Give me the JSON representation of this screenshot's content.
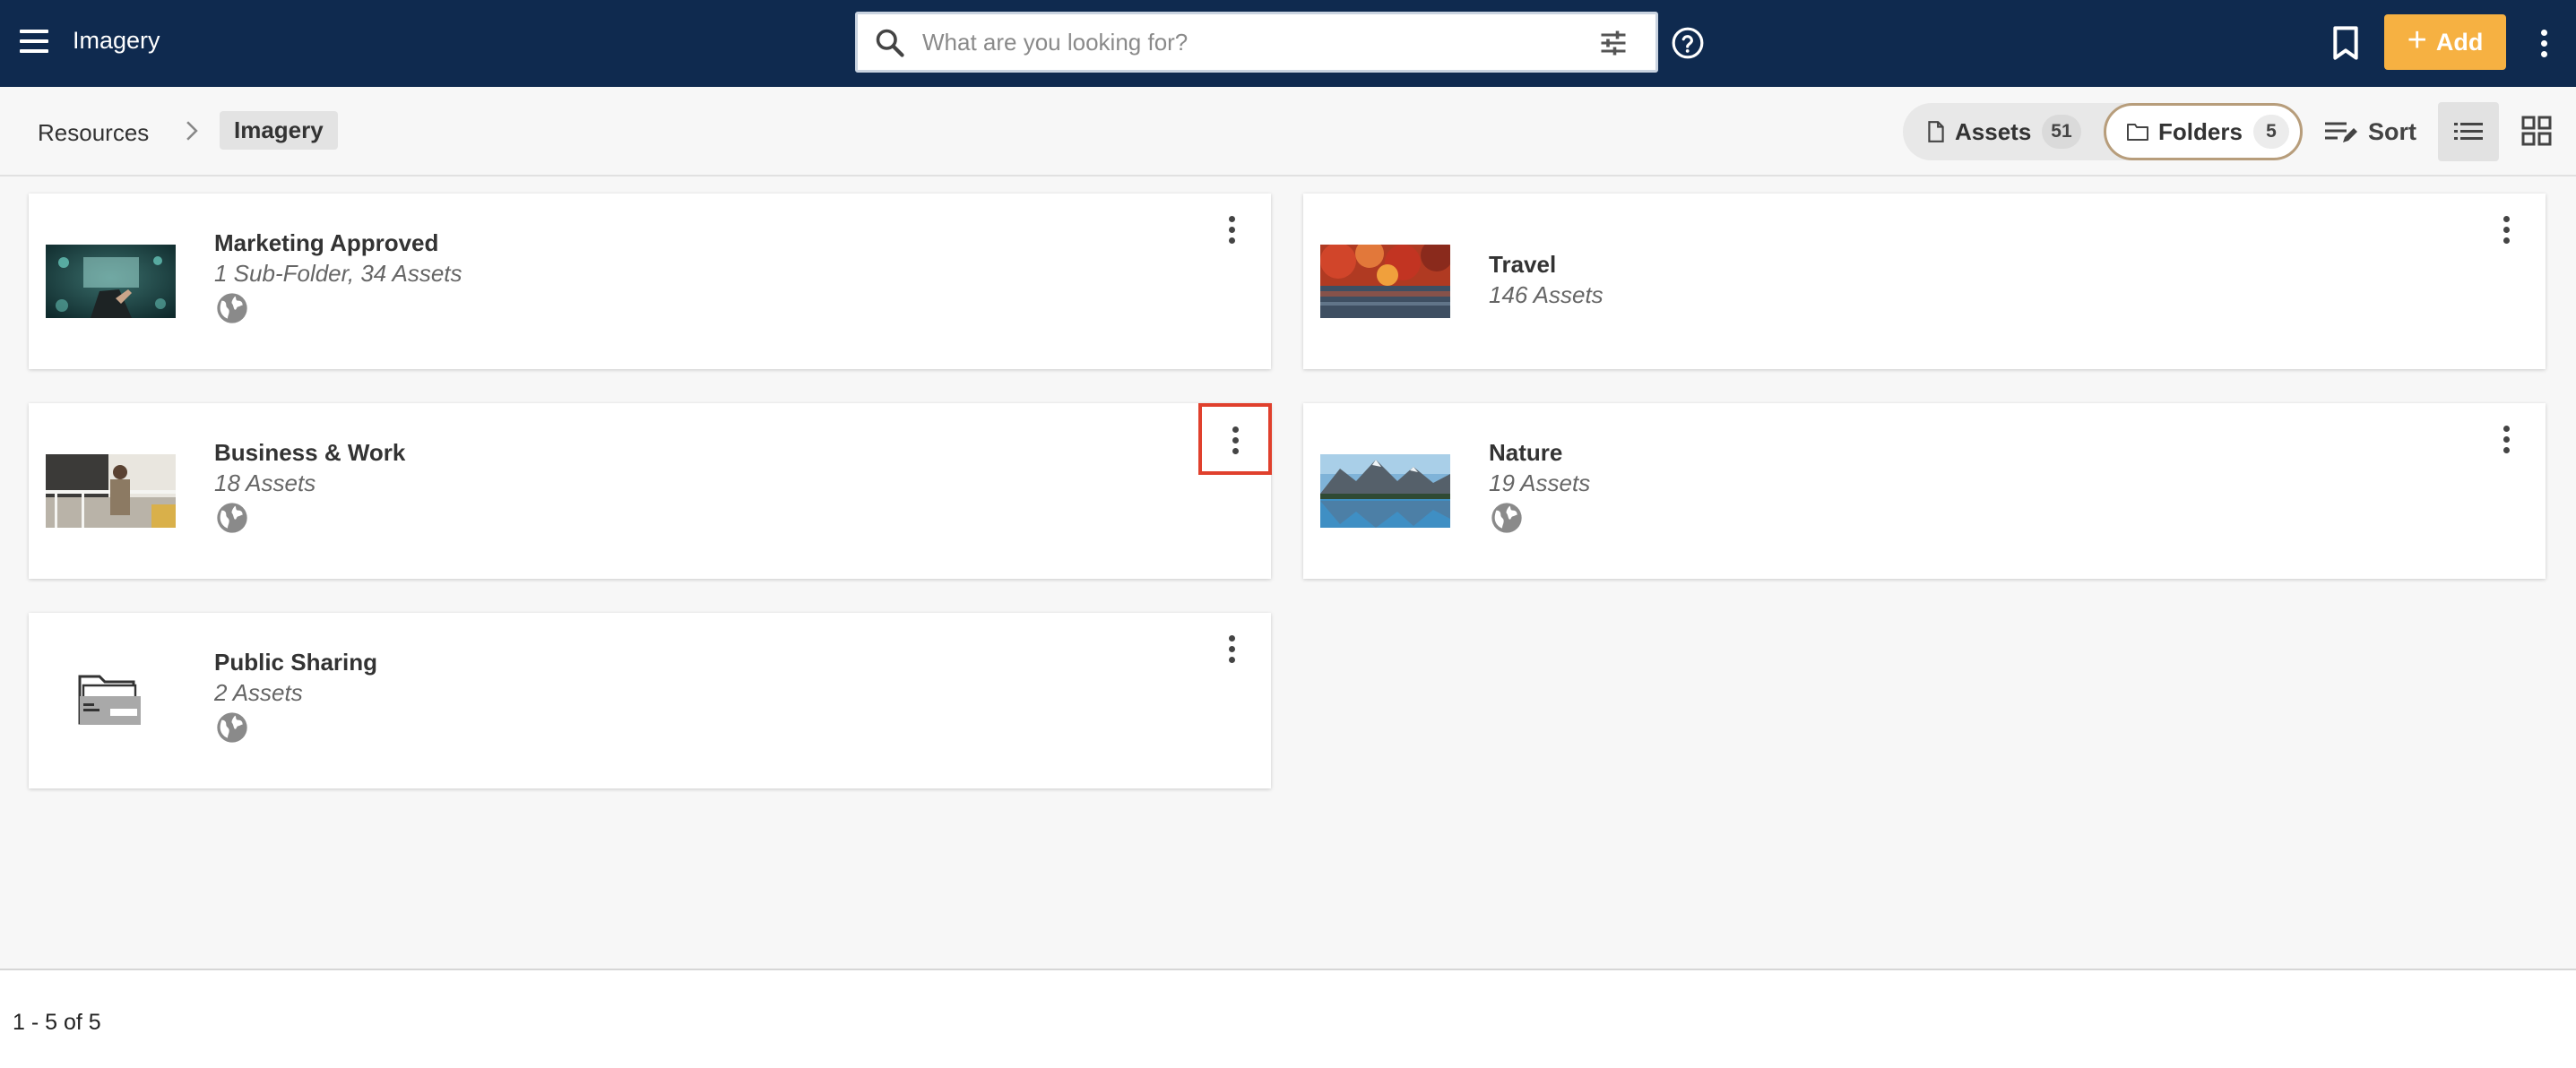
{
  "header": {
    "app_title": "Imagery",
    "search_placeholder": "What are you looking for?",
    "add_label": "Add",
    "add_plus": "+"
  },
  "breadcrumb": {
    "root": "Resources",
    "current": "Imagery"
  },
  "toolbar": {
    "assets_label": "Assets",
    "assets_count": "51",
    "folders_label": "Folders",
    "folders_count": "5",
    "sort_label": "Sort",
    "active_tab": "Folders",
    "active_view": "list"
  },
  "folders": [
    {
      "title": "Marketing Approved",
      "subtitle": "1 Sub-Folder, 34 Assets",
      "public": true,
      "thumbnail": "tech-hands-image"
    },
    {
      "title": "Travel",
      "subtitle": "146 Assets",
      "public": false,
      "thumbnail": "autumn-lake-image"
    },
    {
      "title": "Business & Work",
      "subtitle": "18 Assets",
      "public": true,
      "thumbnail": "balcony-person-image"
    },
    {
      "title": "Nature",
      "subtitle": "19 Assets",
      "public": true,
      "thumbnail": "mountain-lake-image"
    },
    {
      "title": "Public Sharing",
      "subtitle": "2 Assets",
      "public": true,
      "thumbnail": "shared-folder-icon"
    }
  ],
  "pagination": {
    "range_text": "1 - 5 of 5"
  },
  "colors": {
    "topbar": "#0f2a4f",
    "accent_add": "#f6b142",
    "focus_outline": "#e0402d"
  }
}
